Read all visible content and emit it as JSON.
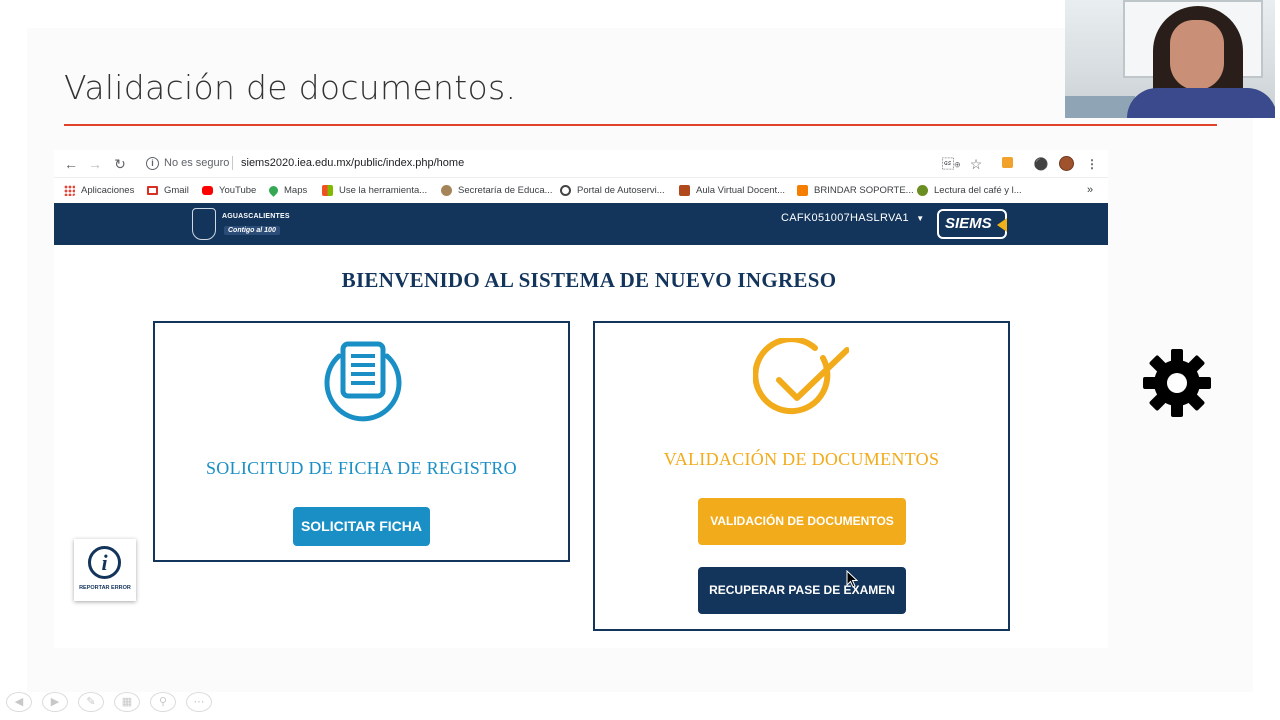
{
  "slide": {
    "title": "Validación de documentos."
  },
  "browser": {
    "security_label": "No es seguro",
    "url": "siems2020.iea.edu.mx/public/index.php/home",
    "bookmarks": [
      {
        "label": "Aplicaciones",
        "icon": "apps-grid-icon",
        "color": "#e8453c"
      },
      {
        "label": "Gmail",
        "icon": "gmail-icon",
        "color": "#d93025"
      },
      {
        "label": "YouTube",
        "icon": "youtube-icon",
        "color": "#ff0000"
      },
      {
        "label": "Maps",
        "icon": "maps-pin-icon",
        "color": "#34a853"
      },
      {
        "label": "Use la herramienta...",
        "icon": "microsoft-icon",
        "color": "#f25022"
      },
      {
        "label": "Secretaría de Educa...",
        "icon": "sep-seal-icon",
        "color": "#a6845a"
      },
      {
        "label": "Portal de Autoservi...",
        "icon": "globe-icon",
        "color": "#444444"
      },
      {
        "label": "Aula Virtual Docent...",
        "icon": "aula-icon",
        "color": "#b04a1c"
      },
      {
        "label": "BRINDAR SOPORTE...",
        "icon": "blogger-icon",
        "color": "#f57d00"
      },
      {
        "label": "Lectura del café y l...",
        "icon": "coffee-icon",
        "color": "#6b8e23"
      }
    ],
    "more_label": "»"
  },
  "site": {
    "brand_name": "AGUASCALIENTES",
    "brand_tagline": "Contigo al 100",
    "user_id": "CAFK051007HASLRVA1",
    "product_badge": "SIEMS",
    "welcome_heading": "BIENVENIDO AL SISTEMA DE NUEVO INGRESO",
    "cards": {
      "registro": {
        "title": "SOLICITUD DE FICHA DE REGISTRO",
        "button": "SOLICITAR FICHA",
        "color": "#1a8fc5"
      },
      "validacion": {
        "title": "VALIDACIÓN DE DOCUMENTOS",
        "button_primary": "VALIDACIÓN DE DOCUMENTOS",
        "button_secondary": "RECUPERAR PASE DE EXAMEN",
        "color": "#f2ab1b"
      }
    },
    "report_label": "REPORTAR ERROR",
    "accent_navy": "#13345b"
  }
}
